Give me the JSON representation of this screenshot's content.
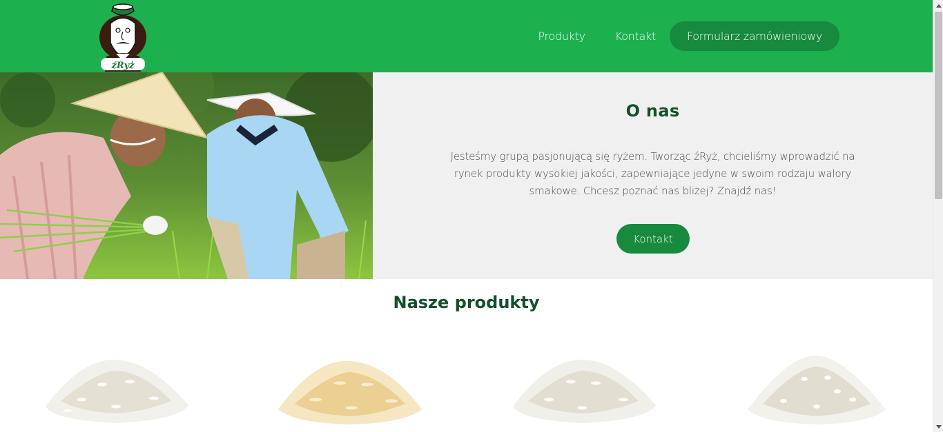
{
  "header": {
    "brand": "źRyż",
    "nav": {
      "products": "Produkty",
      "contact": "Kontakt",
      "order_form": "Formularz zamówieniowy"
    }
  },
  "about": {
    "title": "O nas",
    "text": "Jesteśmy grupą pasjonującą się ryżem. Tworząc źRyż, chcieliśmy wprowadzić na rynek produkty wysokiej jakości, zapewniające jedyne w swoim rodzaju walory smakowe. Chcesz poznać nas bliżej? Znajdź nas!",
    "button": "Kontakt"
  },
  "products": {
    "title": "Nasze produkty",
    "items": [
      {
        "name": "rice-white"
      },
      {
        "name": "rice-parboiled"
      },
      {
        "name": "rice-long-grain"
      },
      {
        "name": "rice-round-grain"
      }
    ]
  },
  "colors": {
    "header": "#1db04f",
    "accent": "#178a3e",
    "panel": "#f0f0f0",
    "heading": "#14502a"
  }
}
